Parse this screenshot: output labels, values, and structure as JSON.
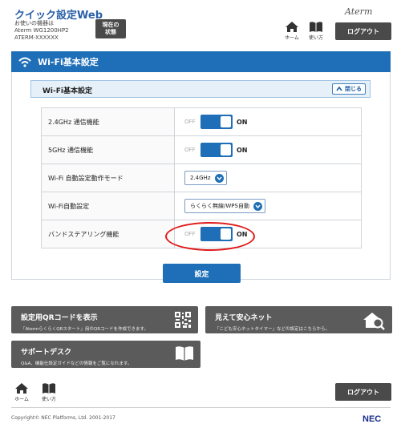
{
  "header": {
    "app_title": "クイック設定Web",
    "device_caption": "お使いの機器は",
    "device_model": "Aterm WG1200HP2",
    "device_name": "ATERM-XXXXXX",
    "status_button_line1": "現在の",
    "status_button_line2": "状態",
    "brand": "Aterm",
    "home_label": "ホーム",
    "help_label": "使い方",
    "logout_label": "ログアウト"
  },
  "main": {
    "section_title": "Wi-Fi基本設定",
    "subsection_title": "Wi-Fi基本設定",
    "collapse_label": "閉じる",
    "rows": [
      {
        "label": "2.4GHz 通信機能",
        "off": "OFF",
        "on": "ON"
      },
      {
        "label": "5GHz 通信機能",
        "off": "OFF",
        "on": "ON"
      },
      {
        "label": "Wi-Fi 自動設定動作モード",
        "select": "2.4GHz"
      },
      {
        "label": "Wi-Fi自動設定",
        "select": "らくらく無線/WPS自動"
      },
      {
        "label": "バンドステアリング機能",
        "off": "OFF",
        "on": "ON"
      }
    ],
    "apply_label": "設定"
  },
  "cards": {
    "qr": {
      "title": "設定用QRコードを表示",
      "desc": "「AtermらくらくQRスタート」用のQRコードを作成できます。"
    },
    "safety": {
      "title": "見えて安心ネット",
      "desc": "「こども安心ネットタイマー」などの設定はこちらから。"
    },
    "support": {
      "title": "サポートデスク",
      "desc": "Q&A、機能仕設定ガイドなどの情報をご覧になれます。"
    }
  },
  "footer": {
    "home_label": "ホーム",
    "help_label": "使い方",
    "logout_label": "ログアウト",
    "copyright": "Copyright© NEC Platforms, Ltd. 2001-2017",
    "logo": "NEC"
  },
  "colors": {
    "accent": "#1e6fb8",
    "dark_button": "#4a4a4a",
    "highlight_ring": "#e01a1a"
  }
}
